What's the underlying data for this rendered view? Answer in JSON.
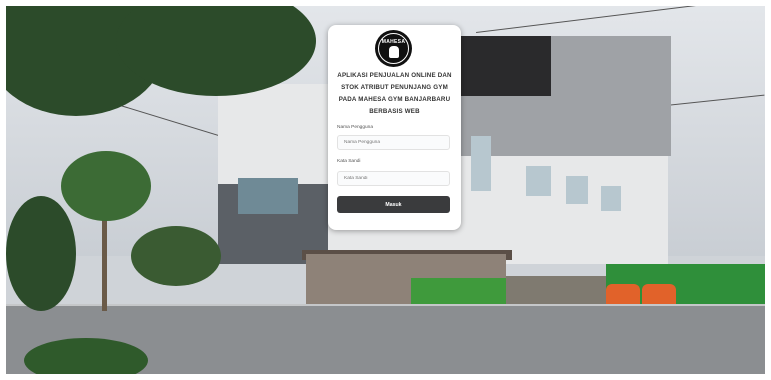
{
  "app": {
    "title_lines": [
      "APLIKASI PENJUALAN ONLINE DAN",
      "STOK ATRIBUT PENUNJANG GYM",
      "PADA MAHESA GYM BANJARBARU",
      "BERBASIS WEB"
    ],
    "logo_text": "MAHESA",
    "logo_icon": "mahesa-gym-logo"
  },
  "login": {
    "username_label": "Nama Pengguna",
    "username_placeholder": "Nama Pengguna",
    "password_label": "Kata Sandi",
    "password_placeholder": "Kata Sandi",
    "submit_label": "Masuk"
  },
  "colors": {
    "card_bg": "#ffffff",
    "button_bg": "#3a3b3d",
    "button_text": "#ffffff"
  }
}
